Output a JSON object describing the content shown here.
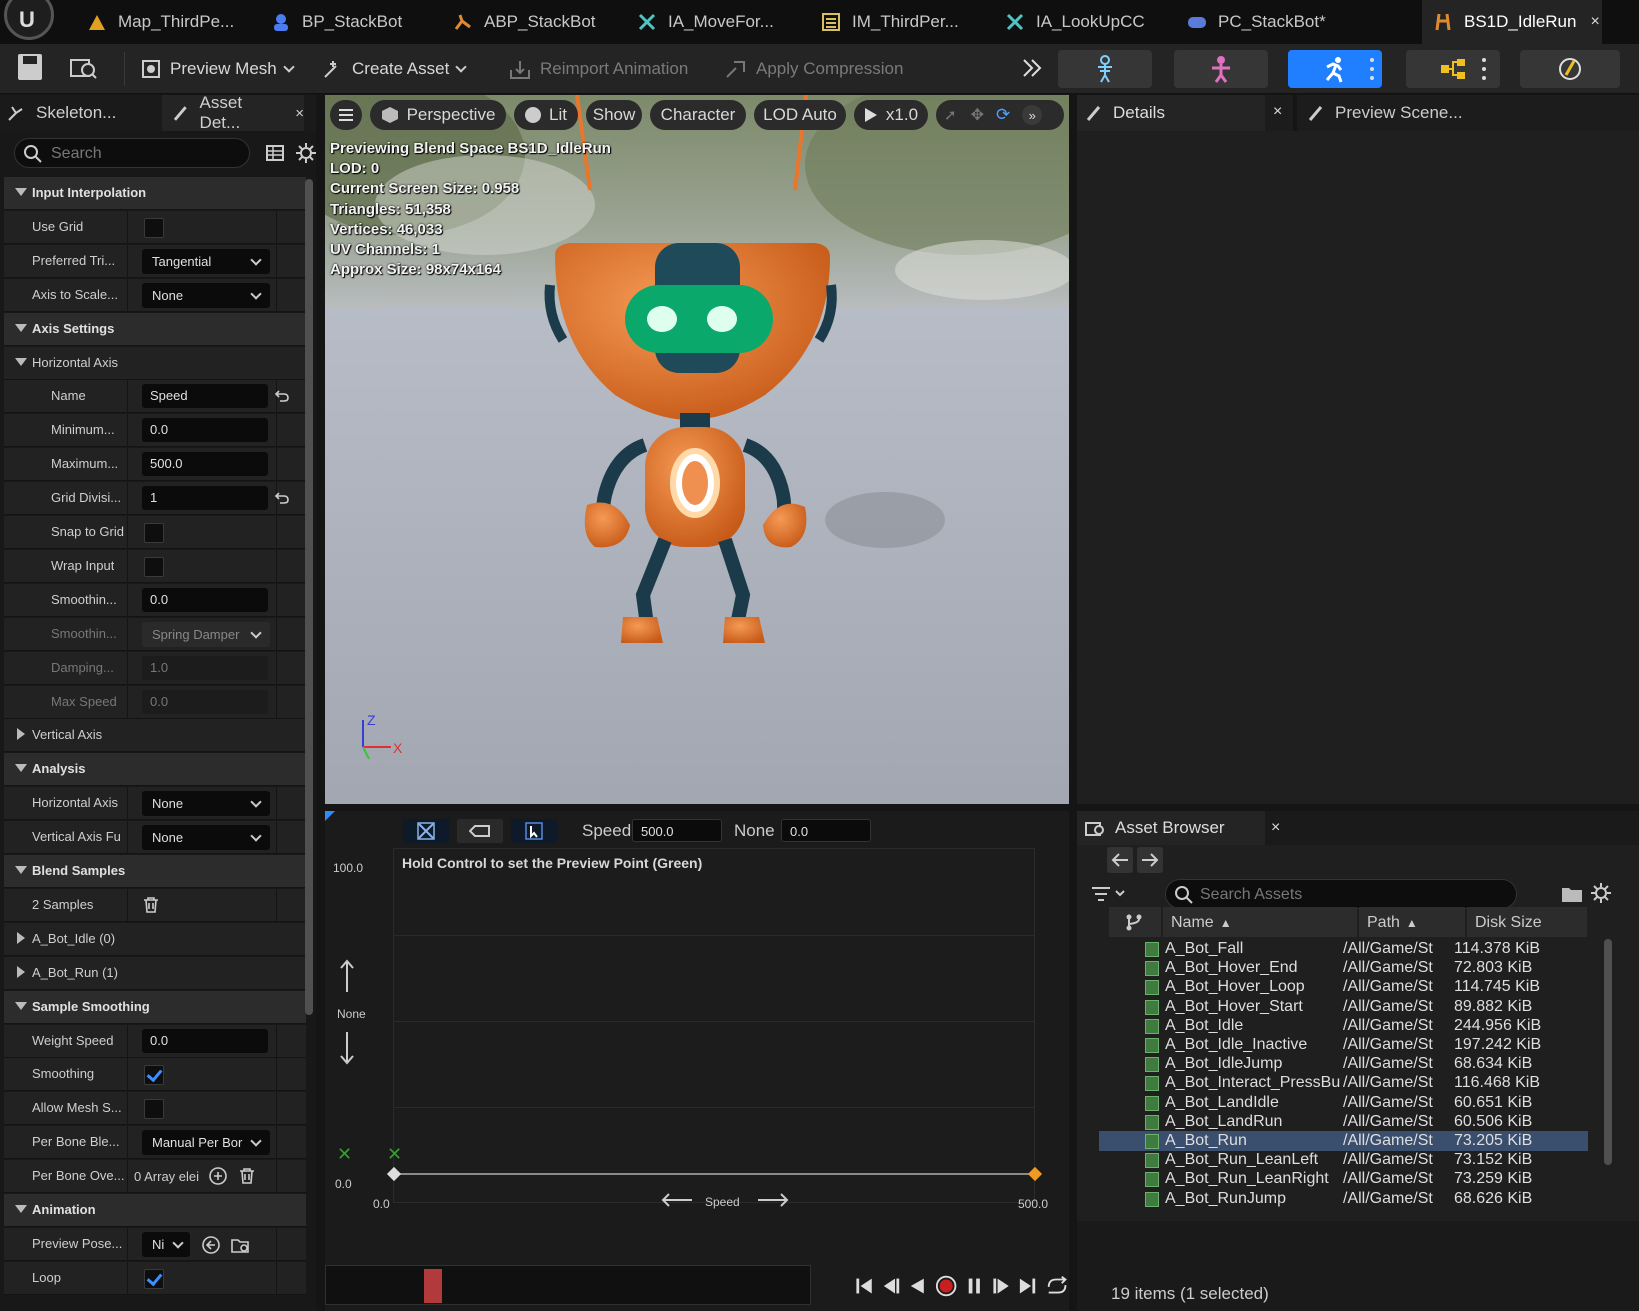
{
  "tabs": [
    {
      "label": "Map_ThirdPe..."
    },
    {
      "label": "BP_StackBot"
    },
    {
      "label": "ABP_StackBot"
    },
    {
      "label": "IA_MoveFor..."
    },
    {
      "label": "IM_ThirdPer..."
    },
    {
      "label": "IA_LookUpCC"
    },
    {
      "label": "PC_StackBot*"
    },
    {
      "label": "BS1D_IdleRun",
      "close": "×"
    }
  ],
  "toolbar": {
    "preview_mesh": "Preview Mesh",
    "create_asset": "Create Asset",
    "reimport": "Reimport Animation",
    "apply_compression": "Apply Compression"
  },
  "left_panel": {
    "tab_skeleton": "Skeleton...",
    "tab_asset_details": "Asset Det...",
    "close": "×",
    "search_placeholder": "Search",
    "rows": [
      {
        "type": "cat",
        "label": "Input Interpolation"
      },
      {
        "label": "Use Grid",
        "check": false
      },
      {
        "label": "Preferred Tri...",
        "dropdown": "Tangential"
      },
      {
        "label": "Axis to Scale...",
        "dropdown": "None"
      },
      {
        "type": "cat",
        "label": "Axis Settings"
      },
      {
        "type": "sub",
        "label": "Horizontal Axis"
      },
      {
        "label": "Name",
        "input": "Speed",
        "reset": true,
        "indent": true
      },
      {
        "label": "Minimum...",
        "input": "0.0",
        "indent": true
      },
      {
        "label": "Maximum...",
        "input": "500.0",
        "indent": true
      },
      {
        "label": "Grid Divisi...",
        "input": "1",
        "reset": true,
        "indent": true
      },
      {
        "label": "Snap to Grid",
        "check": false,
        "indent": true
      },
      {
        "label": "Wrap Input",
        "check": false,
        "indent": true
      },
      {
        "label": "Smoothin...",
        "input": "0.0",
        "indent": true
      },
      {
        "label": "Smoothin...",
        "dropdown": "Spring Damper",
        "disabled": true,
        "indent": true
      },
      {
        "label": "Damping...",
        "input": "1.0",
        "disabled": true,
        "indent": true
      },
      {
        "label": "Max Speed",
        "input": "0.0",
        "disabled": true,
        "indent": true
      },
      {
        "type": "collapsed",
        "label": "Vertical Axis"
      },
      {
        "type": "cat",
        "label": "Analysis"
      },
      {
        "label": "Horizontal Axis",
        "dropdown": "None"
      },
      {
        "label": "Vertical Axis Fu",
        "dropdown": "None"
      },
      {
        "type": "cat",
        "label": "Blend Samples"
      },
      {
        "label": "2 Samples",
        "trash": true
      },
      {
        "type": "collapsed",
        "label": "A_Bot_Idle (0)"
      },
      {
        "type": "collapsed",
        "label": "A_Bot_Run (1)"
      },
      {
        "type": "cat",
        "label": "Sample Smoothing"
      },
      {
        "label": "Weight Speed",
        "input": "0.0"
      },
      {
        "label": "Smoothing",
        "check": true
      },
      {
        "label": "Allow Mesh S...",
        "check": false
      },
      {
        "label": "Per Bone Ble...",
        "dropdown": "Manual Per Bor"
      },
      {
        "label": "Per Bone Ove...",
        "text": "0 Array elei",
        "plus": true,
        "trash": true
      },
      {
        "type": "cat",
        "label": "Animation"
      },
      {
        "label": "Preview Pose...",
        "smalldd": "Ni",
        "extra": true
      },
      {
        "label": "Loop",
        "check": true
      }
    ]
  },
  "viewport": {
    "perspective": "Perspective",
    "lit": "Lit",
    "show": "Show",
    "character": "Character",
    "lod": "LOD Auto",
    "speed": "x1.0",
    "stats": [
      "Previewing Blend Space BS1D_IdleRun",
      "LOD: 0",
      "Current Screen Size: 0.958",
      "Triangles: 51,358",
      "Vertices: 46,033",
      "UV Channels: 1",
      "Approx Size: 98x74x164"
    ],
    "axis_z": "Z",
    "axis_x": "X"
  },
  "details": {
    "tab": "Details",
    "tab2": "Preview Scene...",
    "close": "×"
  },
  "blend": {
    "speed_label": "Speed",
    "speed_value": "500.0",
    "none_label": "None",
    "none_value": "0.0",
    "y_max": "100.0",
    "y_min": "0.0",
    "x_min": "0.0",
    "x_max": "500.0",
    "hint": "Hold Control to set the Preview Point (Green)",
    "y_axis_name": "None",
    "x_axis_name": "Speed"
  },
  "asset_browser": {
    "title": "Asset Browser",
    "close": "×",
    "search_placeholder": "Search Assets",
    "col_name": "Name",
    "col_path": "Path",
    "col_size": "Disk Size",
    "rows": [
      {
        "name": "A_Bot_Fall",
        "path": "/All/Game/St",
        "size": "114.378 KiB"
      },
      {
        "name": "A_Bot_Hover_End",
        "path": "/All/Game/St",
        "size": "72.803 KiB"
      },
      {
        "name": "A_Bot_Hover_Loop",
        "path": "/All/Game/St",
        "size": "114.745 KiB"
      },
      {
        "name": "A_Bot_Hover_Start",
        "path": "/All/Game/St",
        "size": "89.882 KiB"
      },
      {
        "name": "A_Bot_Idle",
        "path": "/All/Game/St",
        "size": "244.956 KiB"
      },
      {
        "name": "A_Bot_Idle_Inactive",
        "path": "/All/Game/St",
        "size": "197.242 KiB"
      },
      {
        "name": "A_Bot_IdleJump",
        "path": "/All/Game/St",
        "size": "68.634 KiB"
      },
      {
        "name": "A_Bot_Interact_PressBu",
        "path": "/All/Game/St",
        "size": "116.468 KiB"
      },
      {
        "name": "A_Bot_LandIdle",
        "path": "/All/Game/St",
        "size": "60.651 KiB"
      },
      {
        "name": "A_Bot_LandRun",
        "path": "/All/Game/St",
        "size": "60.506 KiB"
      },
      {
        "name": "A_Bot_Run",
        "path": "/All/Game/St",
        "size": "73.205 KiB",
        "selected": true
      },
      {
        "name": "A_Bot_Run_LeanLeft",
        "path": "/All/Game/St",
        "size": "73.152 KiB"
      },
      {
        "name": "A_Bot_Run_LeanRight",
        "path": "/All/Game/St",
        "size": "73.259 KiB"
      },
      {
        "name": "A_Bot_RunJump",
        "path": "/All/Game/St",
        "size": "68.626 KiB"
      }
    ],
    "footer": "19 items (1 selected)"
  },
  "colors": {
    "accent": "#1f7fff",
    "robot_orange": "#e8762d",
    "eye_green": "#2aff90"
  }
}
